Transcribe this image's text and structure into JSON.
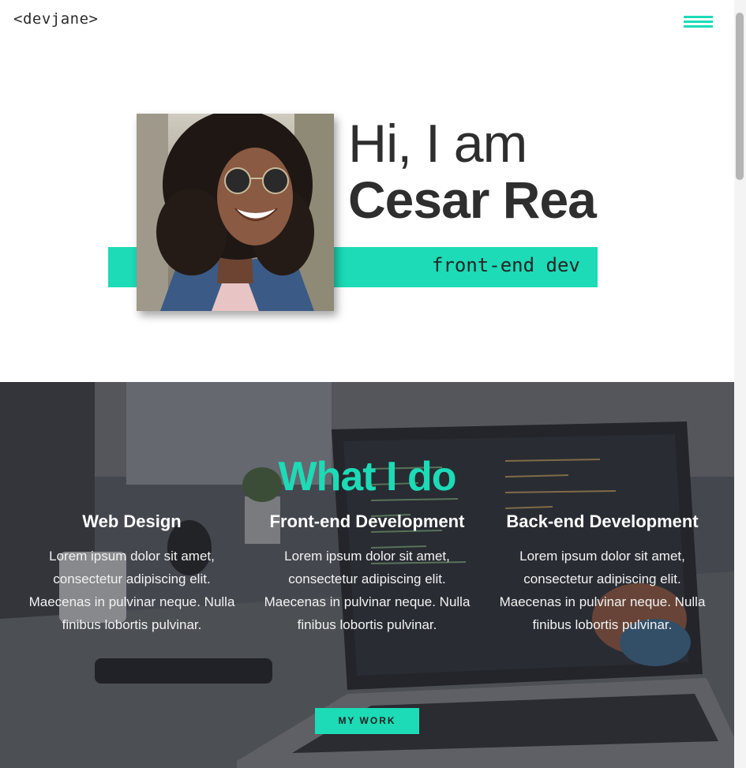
{
  "header": {
    "logo": "<devjane>",
    "menu_icon": "hamburger-menu-icon"
  },
  "hero": {
    "greeting": "Hi, I am",
    "name": "Cesar Rea",
    "role": "front-end dev"
  },
  "services": {
    "title": "What I do",
    "items": [
      {
        "title": "Web Design",
        "description": "Lorem ipsum dolor sit amet, consectetur adipiscing elit. Maecenas in pulvinar neque. Nulla finibus lobortis pulvinar."
      },
      {
        "title": "Front-end Development",
        "description": "Lorem ipsum dolor sit amet, consectetur adipiscing elit. Maecenas in pulvinar neque. Nulla finibus lobortis pulvinar."
      },
      {
        "title": "Back-end Development",
        "description": "Lorem ipsum dolor sit amet, consectetur adipiscing elit. Maecenas in pulvinar neque. Nulla finibus lobortis pulvinar."
      }
    ],
    "button_label": "MY WORK"
  },
  "colors": {
    "accent": "#1cdbb6",
    "text_dark": "#2e2e2e",
    "background": "#ffffff",
    "section_overlay": "#34363c"
  }
}
